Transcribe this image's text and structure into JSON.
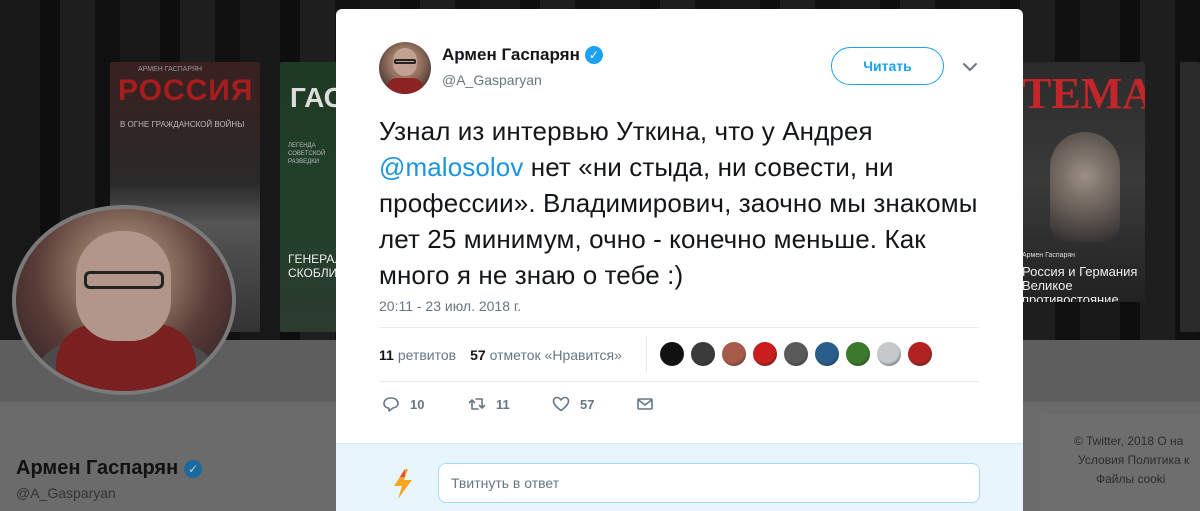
{
  "background": {
    "book1": {
      "author": "АРМЕН ГАСПАРЯН",
      "title": "РОССИЯ",
      "subtitle": "В ОГНЕ ГРАЖДАНСКОЙ ВОЙНЫ"
    },
    "book2": {
      "title": "ГАС",
      "subtitle": "ЛЕГЕНДА СОВЕТСКОЙ РАЗВЕДКИ",
      "bottom": "ГЕНЕРАЛ СКОБЛИН"
    },
    "book3": {
      "title": "ТЕМА",
      "subtitle": "Армен Гаспарян",
      "bottom": "Россия и Германия Великое противостояние"
    },
    "profile_name": "Армен Гаспарян",
    "profile_handle": "@A_Gasparyan",
    "footer": {
      "line1": "© Twitter, 2018   О на",
      "line2": "Условия   Политика к",
      "line3": "Файлы cooki"
    }
  },
  "tweet": {
    "author_name": "Армен Гаспарян",
    "author_handle": "@A_Gasparyan",
    "follow_label": "Читать",
    "text_before": "Узнал из интервью Уткина, что у Андрея ",
    "mention": "@malosolov",
    "text_after": " нет «ни стыда, ни совести, ни профессии». Владимирович, заочно мы знакомы лет 25 минимум, очно - конечно меньше. Как много я не знаю о тебе :)",
    "timestamp": "20:11 - 23 июл. 2018 г.",
    "retweets_count": "11",
    "retweets_label": "ретвитов",
    "likes_count": "57",
    "likes_label": "отметок «Нравится»",
    "likers": [
      "#111111",
      "#3b3b3b",
      "#a55a4a",
      "#c81e1e",
      "#5a5a5a",
      "#2a5e8a",
      "#3a7a2a",
      "#c5c9cc",
      "#b22222"
    ],
    "actions": {
      "replies": "10",
      "retweets": "11",
      "likes": "57"
    },
    "reply_placeholder": "Твитнуть в ответ"
  },
  "colors": {
    "accent": "#1da1f2",
    "mention": "#1b95e0",
    "muted": "#657786"
  }
}
